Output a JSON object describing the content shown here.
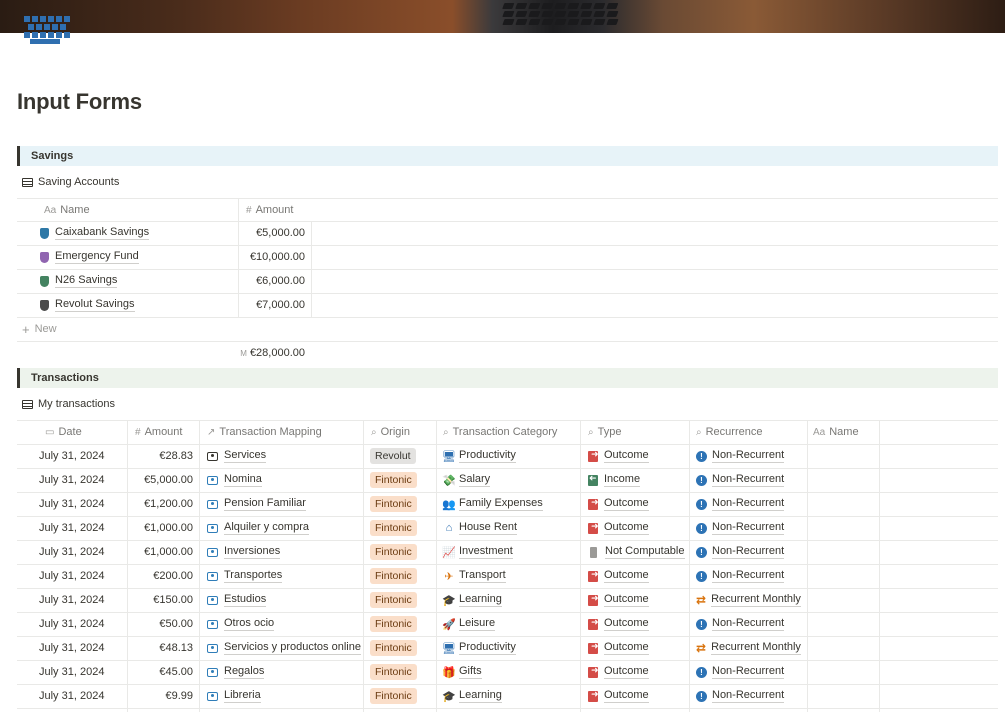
{
  "page": {
    "title": "Input Forms",
    "page_icon": "keyboard-icon"
  },
  "savings": {
    "heading": "Savings",
    "view_title": "Saving Accounts",
    "columns": {
      "name": "Name",
      "amount": "Amount"
    },
    "rows": [
      {
        "name": "Caixabank Savings",
        "amount": "€5,000.00",
        "icon_color": "#2e78a6"
      },
      {
        "name": "Emergency Fund",
        "amount": "€10,000.00",
        "icon_color": "#9065b0"
      },
      {
        "name": "N26 Savings",
        "amount": "€6,000.00",
        "icon_color": "#448361"
      },
      {
        "name": "Revolut Savings",
        "amount": "€7,000.00",
        "icon_color": "#4b4b4b"
      }
    ],
    "new_label": "New",
    "sum_prefix": "M",
    "sum_value": "€28,000.00"
  },
  "transactions": {
    "heading": "Transactions",
    "view_title": "My transactions",
    "columns": {
      "date": "Date",
      "amount": "Amount",
      "mapping": "Transaction Mapping",
      "origin": "Origin",
      "category": "Transaction Category",
      "type": "Type",
      "recurrence": "Recurrence",
      "name": "Name"
    },
    "rows": [
      {
        "date": "July 31, 2024",
        "amount": "€28.83",
        "mapping": "Services",
        "origin": "Revolut",
        "category": "Productivity",
        "category_icon": "monitor-icon",
        "type": "Outcome",
        "recurrence": "Non-Recurrent"
      },
      {
        "date": "July 31, 2024",
        "amount": "€5,000.00",
        "mapping": "Nomina",
        "origin": "Fintonic",
        "category": "Salary",
        "category_icon": "money-icon",
        "type": "Income",
        "recurrence": "Non-Recurrent"
      },
      {
        "date": "July 31, 2024",
        "amount": "€1,200.00",
        "mapping": "Pension Familiar",
        "origin": "Fintonic",
        "category": "Family Expenses",
        "category_icon": "people-icon",
        "type": "Outcome",
        "recurrence": "Non-Recurrent"
      },
      {
        "date": "July 31, 2024",
        "amount": "€1,000.00",
        "mapping": "Alquiler y compra",
        "origin": "Fintonic",
        "category": "House Rent",
        "category_icon": "house-icon",
        "type": "Outcome",
        "recurrence": "Non-Recurrent"
      },
      {
        "date": "July 31, 2024",
        "amount": "€1,000.00",
        "mapping": "Inversiones",
        "origin": "Fintonic",
        "category": "Investment",
        "category_icon": "chart-icon",
        "type": "Not Computable",
        "recurrence": "Non-Recurrent"
      },
      {
        "date": "July 31, 2024",
        "amount": "€200.00",
        "mapping": "Transportes",
        "origin": "Fintonic",
        "category": "Transport",
        "category_icon": "airplane-icon",
        "type": "Outcome",
        "recurrence": "Non-Recurrent"
      },
      {
        "date": "July 31, 2024",
        "amount": "€150.00",
        "mapping": "Estudios",
        "origin": "Fintonic",
        "category": "Learning",
        "category_icon": "graduation-cap-icon",
        "type": "Outcome",
        "recurrence": "Recurrent Monthly"
      },
      {
        "date": "July 31, 2024",
        "amount": "€50.00",
        "mapping": "Otros ocio",
        "origin": "Fintonic",
        "category": "Leisure",
        "category_icon": "rocket-icon",
        "type": "Outcome",
        "recurrence": "Non-Recurrent"
      },
      {
        "date": "July 31, 2024",
        "amount": "€48.13",
        "mapping": "Servicios y productos online",
        "origin": "Fintonic",
        "category": "Productivity",
        "category_icon": "monitor-icon",
        "type": "Outcome",
        "recurrence": "Recurrent Monthly"
      },
      {
        "date": "July 31, 2024",
        "amount": "€45.00",
        "mapping": "Regalos",
        "origin": "Fintonic",
        "category": "Gifts",
        "category_icon": "gift-icon",
        "type": "Outcome",
        "recurrence": "Non-Recurrent"
      },
      {
        "date": "July 31, 2024",
        "amount": "€9.99",
        "mapping": "Libreria",
        "origin": "Fintonic",
        "category": "Learning",
        "category_icon": "graduation-cap-icon",
        "type": "Outcome",
        "recurrence": "Non-Recurrent"
      }
    ]
  }
}
